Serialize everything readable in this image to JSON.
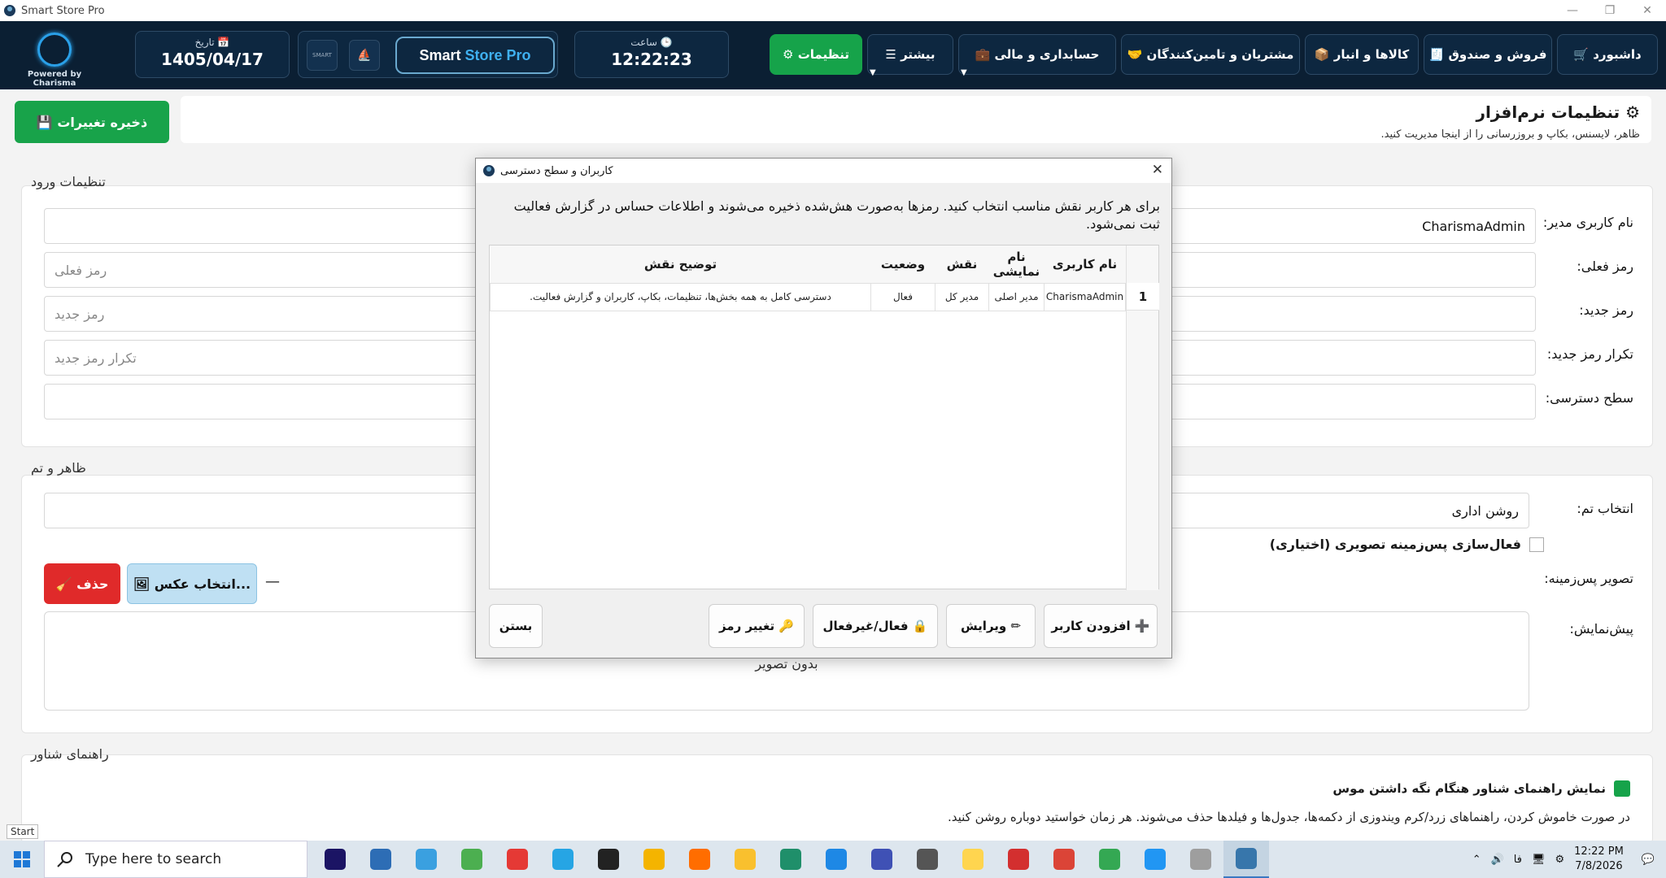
{
  "window": {
    "title": "Smart Store Pro",
    "controls": [
      "—",
      "❐",
      "✕"
    ]
  },
  "navbar": {
    "powered_by": "Powered by Charisma",
    "date_label": "تاریخ 📅",
    "date_value": "1405/04/17",
    "brand_main": "Smart",
    "brand_highlight": "Store Pro",
    "mini_logo_text": "SMART",
    "time_label": "ساعت 🕒",
    "time_value": "12:22:23",
    "menu": [
      {
        "label": "⚙ تنظیمات"
      },
      {
        "label": "☰ بیشتر"
      },
      {
        "label": "💼 حسابداری و مالی"
      },
      {
        "label": "🤝 مشتریان و تامین‌کنندگان"
      },
      {
        "label": "📦 کالاها و انبار"
      },
      {
        "label": "🧾 فروش و صندوق"
      },
      {
        "label": "🛒 داشبورد"
      }
    ],
    "caret": "▼"
  },
  "page": {
    "title": "⚙ تنظیمات نرم‌افزار",
    "subtitle": "ظاهر، لایسنس، بکاپ و بروزرسانی را از اینجا مدیریت کنید.",
    "save_label": "💾 ذخیره تغییرات"
  },
  "login": {
    "title": "تنظیمات ورود",
    "admin_user_label": "نام کاربری مدیر:",
    "admin_user_value": "CharismaAdmin",
    "current_pass_label": "رمز فعلی:",
    "current_pass_placeholder": "رمز فعلی",
    "new_pass_label": "رمز جدید:",
    "new_pass_placeholder": "رمز جدید",
    "repeat_pass_label": "تکرار رمز جدید:",
    "repeat_pass_placeholder": "تکرار رمز جدید",
    "access_label": "سطح دسترسی:"
  },
  "theme": {
    "title": "ظاهر و تم",
    "select_label": "انتخاب تم:",
    "select_value": "روشن اداری",
    "bg_check_label": "فعال‌سازی پس‌زمینه تصویری (اختیاری)",
    "bg_image_label": "تصویر پس‌زمینه:",
    "delete_label": "🧹 حذف",
    "pick_label": "🖼 انتخاب عکس...",
    "dash": "—",
    "preview_label": "پیش‌نمایش:",
    "preview_placeholder": "بدون تصویر"
  },
  "hint": {
    "title": "راهنمای شناور",
    "check_label": "نمایش راهنمای شناور هنگام نگه داشتن موس",
    "description": "در صورت خاموش کردن، راهنماهای زرد/کرم ویندوزی از دکمه‌ها، جدول‌ها و فیلدها حذف می‌شوند. هر زمان خواستید دوباره روشن کنید."
  },
  "start_tip": "Start",
  "dialog": {
    "title": "کاربران و سطح دسترسی",
    "close": "✕",
    "message": "برای هر کاربر نقش مناسب انتخاب کنید. رمزها به‌صورت هش‌شده ذخیره می‌شوند و اطلاعات حساس در گزارش فعالیت ثبت نمی‌شود.",
    "columns": [
      "نام کاربری",
      "نام نمایشی",
      "نقش",
      "وضعیت",
      "توضیح نقش"
    ],
    "rows": [
      {
        "num": "1",
        "username": "CharismaAdmin",
        "display": "مدیر اصلی",
        "role": "مدیر کل",
        "status": "فعال",
        "desc": "دسترسی کامل به همه بخش‌ها، تنظیمات، بکاپ، کاربران و گزارش فعالیت."
      }
    ],
    "buttons": {
      "add": "➕ افزودن کاربر",
      "edit": "✏ ویرایش",
      "toggle": "🔒 فعال/غیرفعال",
      "change_pass": "🔑 تغییر رمز",
      "close": "بستن"
    }
  },
  "taskbar": {
    "search_placeholder": "Type here to search",
    "icons": [
      "after-effects",
      "file-explorer-alt",
      "photos",
      "utorrent",
      "podcast",
      "telegram",
      "wordpress",
      "chrome",
      "pinwheel",
      "folder",
      "app-green",
      "vscode",
      "charts",
      "openai",
      "sticky-notes",
      "vivaldi",
      "chrome-red",
      "chrome-green",
      "photos-blue",
      "files",
      "python"
    ],
    "lang": "فا",
    "time": "12:22 PM",
    "date": "7/8/2026"
  }
}
